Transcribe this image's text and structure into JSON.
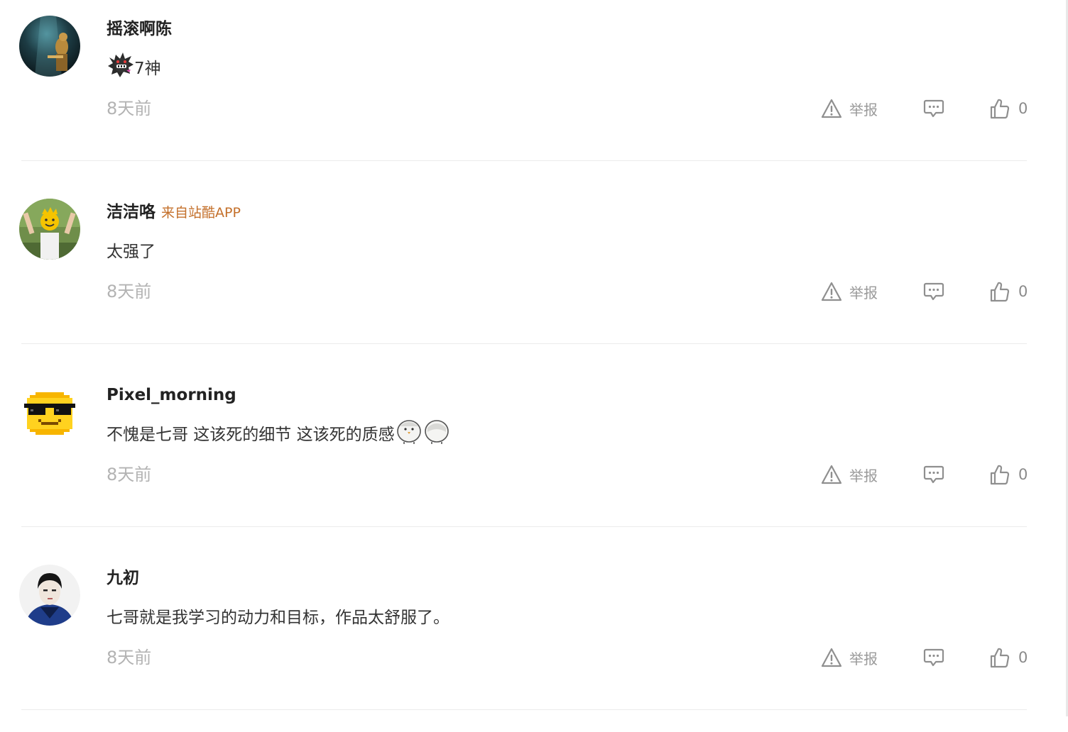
{
  "comments": [
    {
      "username": "摇滚啊陈",
      "source": "",
      "content": "7神",
      "content_emojis": [
        "devil-bird-emoji"
      ],
      "time": "8天前",
      "report_label": "举报",
      "likes": "0"
    },
    {
      "username": "洁洁咯",
      "source": "来自站酷APP",
      "content": "太强了",
      "content_emojis": [],
      "time": "8天前",
      "report_label": "举报",
      "likes": "0"
    },
    {
      "username": "Pixel_morning",
      "source": "",
      "content": "不愧是七哥 这该死的细节 这该死的质感",
      "content_emojis": [
        "chick-emoji",
        "chick-emoji"
      ],
      "time": "8天前",
      "report_label": "举报",
      "likes": "0"
    },
    {
      "username": "九初",
      "source": "",
      "content": "七哥就是我学习的动力和目标，作品太舒服了。",
      "content_emojis": [],
      "time": "8天前",
      "report_label": "举报",
      "likes": "0"
    }
  ],
  "icons": {
    "report": "warning-triangle-icon",
    "reply": "chat-bubble-icon",
    "like": "thumbs-up-icon"
  },
  "colors": {
    "source_link": "#c4702b",
    "muted": "#b3b3b3",
    "icon": "#9a9a9a"
  }
}
